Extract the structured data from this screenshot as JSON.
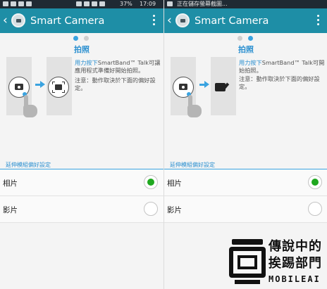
{
  "status_bar": {
    "battery": "37%",
    "time": "17:09",
    "notification": "正在儲存螢幕截圖..."
  },
  "app": {
    "title": "Smart Camera",
    "back_icon": "back-chevron-icon",
    "overflow_icon": "overflow-menu-icon"
  },
  "screens": [
    {
      "page_indicator": {
        "active": 0,
        "count": 2
      },
      "heading": "拍照",
      "desc_highlight": "用力按下",
      "desc_rest": "SmartBand™ Talk可讓應用程式準備好開始拍照。",
      "note": "注意：動作取決於下面的偏好設定。",
      "result_icon": "camera-focus-icon"
    },
    {
      "page_indicator": {
        "active": 1,
        "count": 2
      },
      "heading": "拍照",
      "desc_highlight": "用力按下",
      "desc_rest": "SmartBand™ Talk可開始拍照。",
      "note": "注意：動作取決於下面的偏好設定。",
      "result_icon": "camera-check-icon"
    }
  ],
  "preferences": {
    "section_title": "延伸模組偏好設定",
    "options": [
      {
        "label": "相片",
        "selected": true
      },
      {
        "label": "影片",
        "selected": false
      }
    ]
  },
  "colors": {
    "action_bar": "#1e8ea6",
    "accent": "#2a8fd0",
    "radio_selected": "#1fa81f",
    "status_bar": "#1f2a33"
  },
  "watermark": {
    "line1": "傳說中的",
    "line2": "挨踢部門",
    "line3": "MOBILEAI"
  }
}
